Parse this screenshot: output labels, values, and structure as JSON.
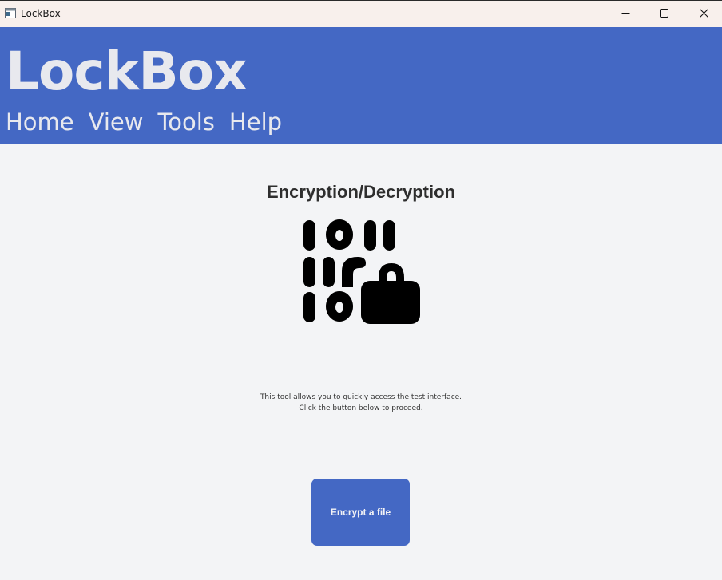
{
  "window": {
    "title": "LockBox",
    "icons": {
      "app": "window-app-icon",
      "minimize": "minimize-icon",
      "maximize": "maximize-icon",
      "close": "close-icon"
    }
  },
  "header": {
    "brand": "LockBox",
    "nav": [
      "Home",
      "View",
      "Tools",
      "Help"
    ]
  },
  "main": {
    "heading": "Encryption/Decryption",
    "icon": "binary-lock-icon",
    "description_line1": "This tool allows you to quickly access the test interface.",
    "description_line2": "Click the button below to proceed.",
    "button_label": "Encrypt a file"
  },
  "colors": {
    "header_bg": "#4468c4",
    "header_text": "#e8e9ee",
    "page_bg": "#f3f4f6",
    "titlebar_bg": "#f8f0ec",
    "button_bg": "#4468c4",
    "heading_text": "#2e2e2e"
  }
}
